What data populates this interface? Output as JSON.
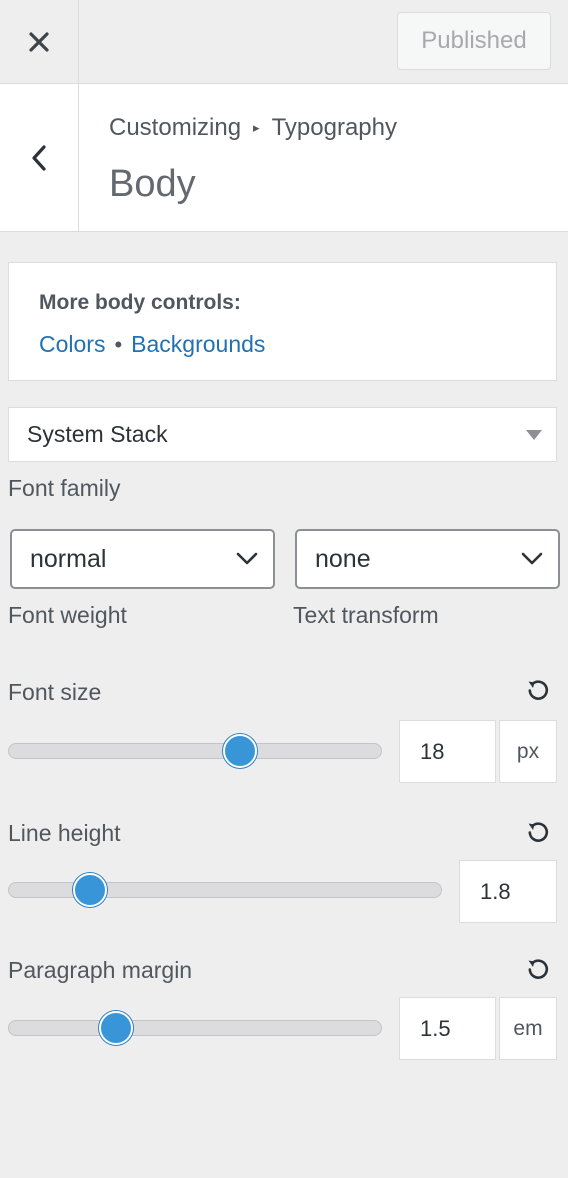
{
  "header": {
    "close_icon": "close-icon",
    "publish_label": "Published"
  },
  "section": {
    "back_icon": "chevron-left-icon",
    "breadcrumb_root": "Customizing",
    "breadcrumb_sep": "▸",
    "breadcrumb_parent": "Typography",
    "title": "Body"
  },
  "info": {
    "heading": "More body controls:",
    "link_colors": "Colors",
    "separator": "•",
    "link_backgrounds": "Backgrounds"
  },
  "font_family": {
    "value": "System Stack",
    "label": "Font family"
  },
  "font_weight": {
    "value": "normal",
    "label": "Font weight"
  },
  "text_transform": {
    "value": "none",
    "label": "Text transform"
  },
  "font_size": {
    "label": "Font size",
    "value": "18",
    "unit": "px",
    "slider_fraction": 0.62
  },
  "line_height": {
    "label": "Line height",
    "value": "1.8",
    "slider_fraction": 0.19
  },
  "paragraph_margin": {
    "label": "Paragraph margin",
    "value": "1.5",
    "unit": "em",
    "slider_fraction": 0.29
  },
  "colors": {
    "accent": "#3895d8",
    "link": "#2271b1",
    "background": "#eeeeee"
  },
  "icons": {
    "reset": "reset-icon",
    "dropdown": "chevron-down-icon"
  }
}
